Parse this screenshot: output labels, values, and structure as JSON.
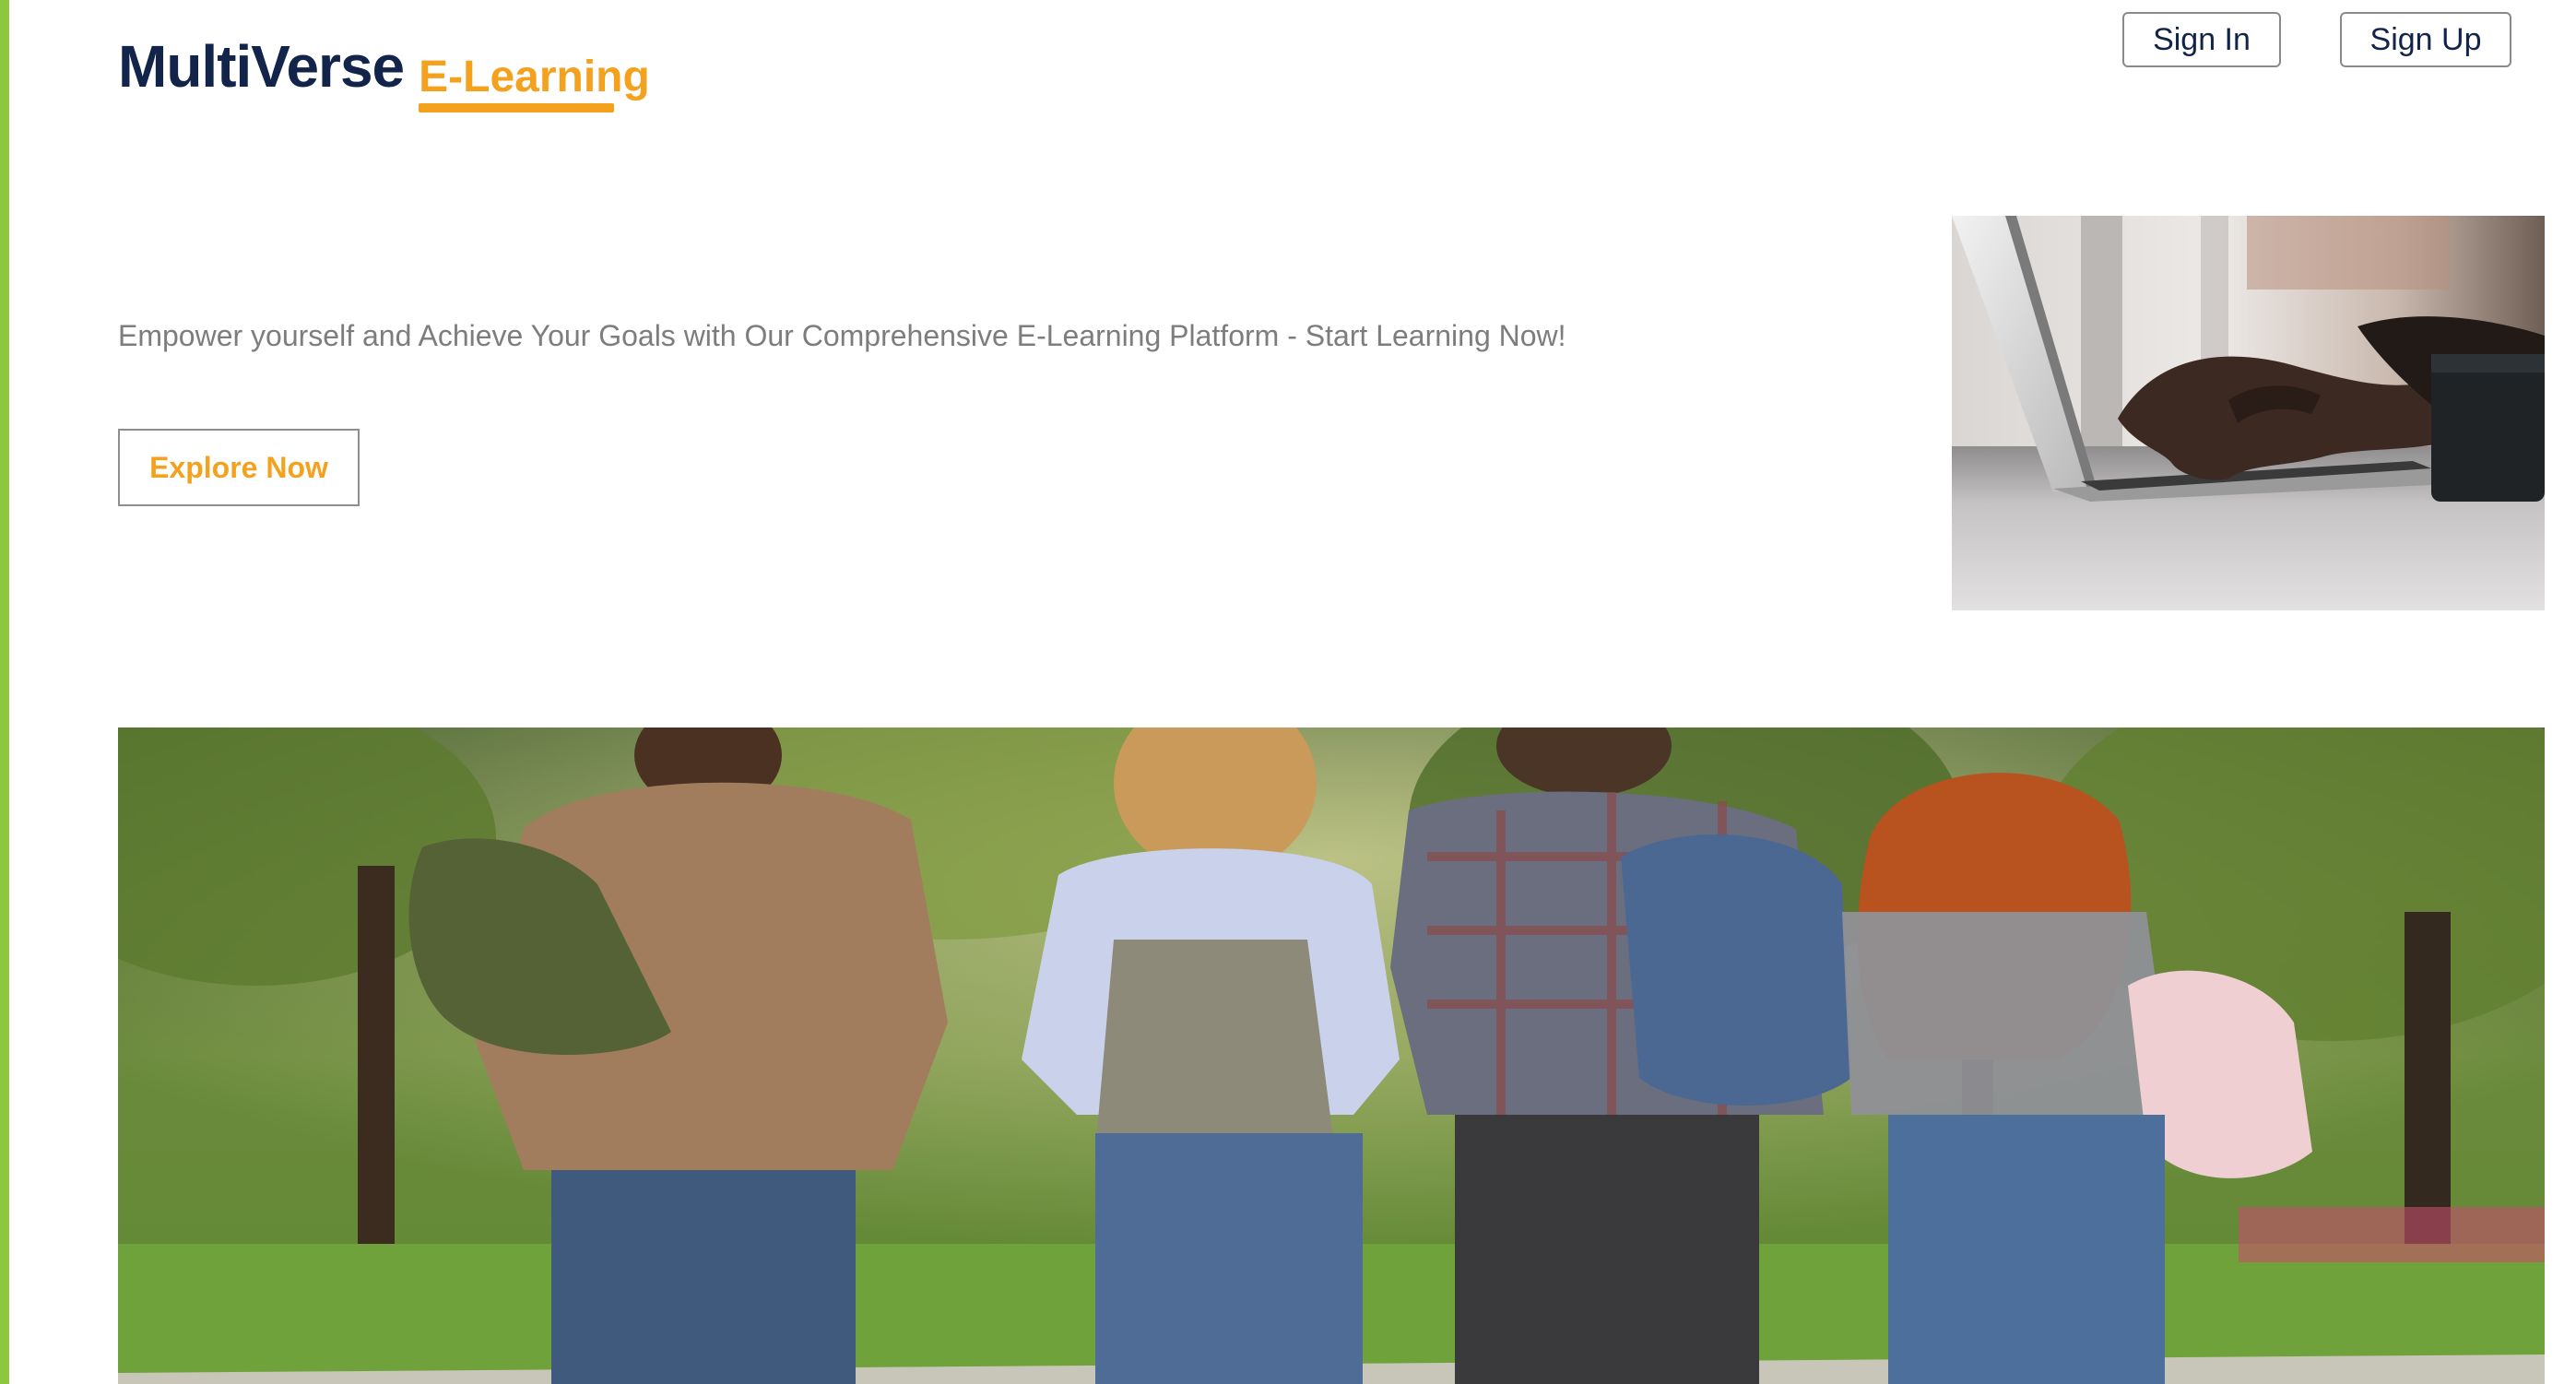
{
  "brand": {
    "name": "MultiVerse",
    "sub": "E-Learning"
  },
  "header": {
    "signin_label": "Sign In",
    "signup_label": "Sign Up"
  },
  "hero": {
    "tagline": "Empower yourself and Achieve Your Goals with Our Comprehensive E-Learning Platform - Start Learning Now!",
    "cta_label": "Explore Now",
    "image_icon": "laptop-typing-photo"
  },
  "banner": {
    "image_icon": "students-walking-photo"
  },
  "colors": {
    "brand_navy": "#12244a",
    "accent_orange": "#f4a11e",
    "accent_green": "#8dc63f",
    "muted_text": "#7d7d7d"
  }
}
